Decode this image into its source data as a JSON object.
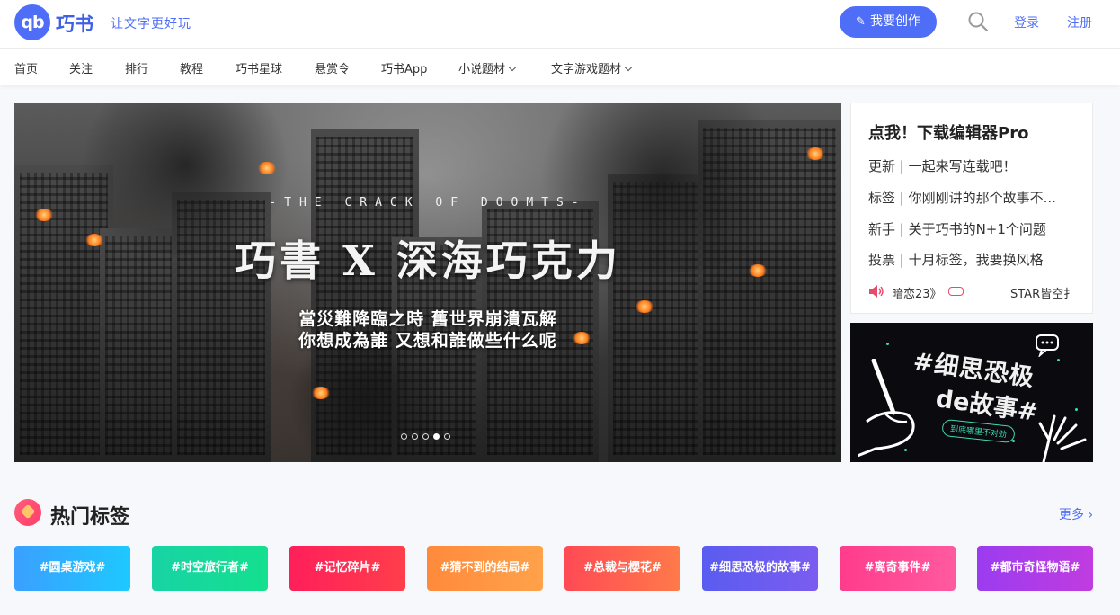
{
  "header": {
    "logo_text": "qb",
    "brand": "巧书",
    "slogan": "让文字更好玩",
    "create_label": "我要创作",
    "login_label": "登录",
    "register_label": "注册"
  },
  "nav": {
    "items": [
      {
        "label": "首页"
      },
      {
        "label": "关注"
      },
      {
        "label": "排行"
      },
      {
        "label": "教程"
      },
      {
        "label": "巧书星球"
      },
      {
        "label": "悬赏令"
      },
      {
        "label": "巧书App"
      },
      {
        "label": "小说题材"
      },
      {
        "label": "文字游戏题材"
      }
    ]
  },
  "banner": {
    "subtitle": "-THE CRACK OF DOOMTS-",
    "title": "巧書 X 深海巧克力",
    "line1": "當災難降臨之時 舊世界崩潰瓦解",
    "line2": "你想成為誰 又想和誰做些什么呢",
    "slide_count": 5,
    "active_slide": 4
  },
  "side_panel": {
    "title": "点我！下载编辑器Pro",
    "links": [
      {
        "label": "更新 | 一起来写连载吧！"
      },
      {
        "label": "标签 | 你刚刚讲的那个故事不..."
      },
      {
        "label": "新手 | 关于巧书的N+1个问题"
      },
      {
        "label": "投票 | 十月标签，我要换风格"
      }
    ],
    "ticker_a": "暗恋23》",
    "ticker_b": "STAR皆空扌"
  },
  "promo": {
    "title_line1": "#细思恐极",
    "title_line2": "de故事#",
    "tag": "到底哪里不对劲"
  },
  "hot_tags": {
    "title": "热门标签",
    "more_label": "更多",
    "items": [
      {
        "label": "#圆桌游戏#",
        "color_from": "#3aa0ff",
        "color_to": "#1ec8ff"
      },
      {
        "label": "#时空旅行者#",
        "color_from": "#18d3a4",
        "color_to": "#14e08f"
      },
      {
        "label": "#记忆碎片#",
        "color_from": "#ff1f5a",
        "color_to": "#ff3e4b"
      },
      {
        "label": "#猜不到的结局#",
        "color_from": "#ff8a3c",
        "color_to": "#ffa24a"
      },
      {
        "label": "#总裁与樱花#",
        "color_from": "#ff4a55",
        "color_to": "#ff7a4a"
      },
      {
        "label": "#细思恐极的故事#",
        "color_from": "#5a5cf0",
        "color_to": "#7b5cf0"
      },
      {
        "label": "#离奇事件#",
        "color_from": "#ff3c8c",
        "color_to": "#ff5aa0"
      },
      {
        "label": "#都市奇怪物语#",
        "color_from": "#9b3cf0",
        "color_to": "#c03ce0"
      }
    ]
  }
}
